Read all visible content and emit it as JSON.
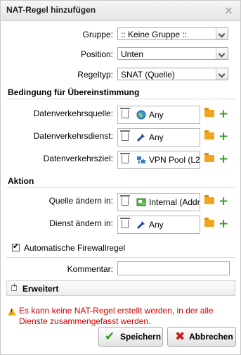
{
  "dialog": {
    "title": "NAT-Regel hinzufügen",
    "close_symbol": "×"
  },
  "form": {
    "gruppe": {
      "label": "Gruppe:",
      "value": ":: Keine Gruppe ::"
    },
    "position": {
      "label": "Position:",
      "value": "Unten"
    },
    "regeltyp": {
      "label": "Regeltyp:",
      "value": "SNAT (Quelle)"
    }
  },
  "sections": {
    "bedingung": "Bedingung für Übereinstimmung",
    "aktion": "Aktion"
  },
  "bedingung": {
    "quelle": {
      "label": "Datenverkehrsquelle:",
      "value": "Any"
    },
    "dienst": {
      "label": "Datenverkehrsdienst:",
      "value": "Any"
    },
    "ziel": {
      "label": "Datenverkehrsziel:",
      "value": "VPN Pool (L2"
    }
  },
  "aktion": {
    "quelle": {
      "label": "Quelle ändern in:",
      "value": "Internal (Addr"
    },
    "dienst": {
      "label": "Dienst ändern in:",
      "value": "Any"
    }
  },
  "firewall_rule": {
    "label": "Automatische Firewallregel",
    "checked": true
  },
  "kommentar": {
    "label": "Kommentar:",
    "value": ""
  },
  "erweitert": {
    "label": "Erweitert"
  },
  "warning": "Es kann keine NAT-Regel erstellt werden, in der alle Dienste zusammengefasst werden.",
  "buttons": {
    "save": "Speichern",
    "cancel": "Abbrechen"
  },
  "icons": {
    "globe": "globe-icon",
    "service": "service-icon",
    "network": "network-icon",
    "host": "host-icon",
    "folder": "folder-icon",
    "plus": "plus-icon",
    "trash": "trash-icon",
    "warning": "warning-icon"
  },
  "colors": {
    "warning_text": "#cc0000",
    "add": "#3a9a2a",
    "folder": "#f0a51c"
  }
}
